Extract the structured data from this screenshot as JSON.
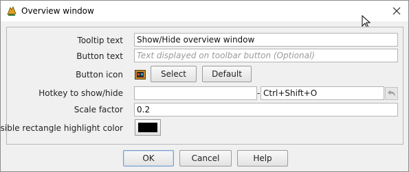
{
  "window": {
    "title": "Overview window",
    "icon": "app-logo-icon"
  },
  "form": {
    "tooltip_label": "Tooltip text",
    "tooltip_value": "Show/Hide overview window",
    "button_text_label": "Button text",
    "button_text_placeholder": "Text displayed on toolbar button (Optional)",
    "button_icon_label": "Button icon",
    "select_label": "Select",
    "default_label": "Default",
    "hotkey_label": "Hotkey to show/hide",
    "hotkey_value": "",
    "hotkey_separator": "-",
    "hotkey_default": "Ctrl+Shift+O",
    "scale_label": "Scale factor",
    "scale_value": "0.2",
    "highlight_label": "Visible rectangle highlight color",
    "highlight_color": "#000000"
  },
  "footer": {
    "ok_label": "OK",
    "cancel_label": "Cancel",
    "help_label": "Help"
  }
}
